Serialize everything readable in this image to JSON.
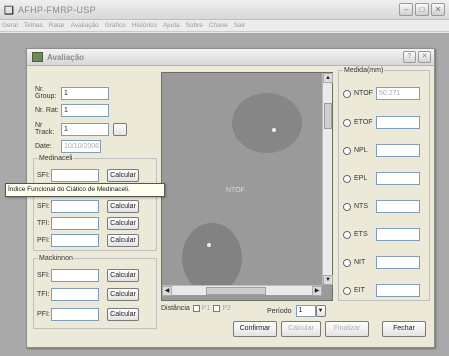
{
  "app": {
    "title": "AFHP-FMRP-USP",
    "menu": [
      "Geral",
      "Telhas",
      "Ratar",
      "Avaliação",
      "Gráfico",
      "Histórico",
      "Ajuda",
      "Sobre",
      "Chave",
      "Sair"
    ]
  },
  "dialog": {
    "title": "Avaliação",
    "fields": {
      "group_label": "Nr. Group:",
      "group_value": "1",
      "rat_label": "Nr. Rat:",
      "rat_value": "1",
      "track_label": "Nr Track:",
      "track_value": "1",
      "date_label": "Date:",
      "date_value": "10/10/2006"
    },
    "medinaceli": {
      "legend": "Medinaceli",
      "rows": [
        {
          "label": "SFI:",
          "button": "Calcular"
        },
        {
          "label": "SFI:",
          "button": "Calcular"
        },
        {
          "label": "TFI:",
          "button": "Calcular"
        },
        {
          "label": "PFI:",
          "button": "Calcular"
        }
      ]
    },
    "mackinnon": {
      "legend": "Mackinnon",
      "rows": [
        {
          "label": "SFI:",
          "button": "Calcular"
        },
        {
          "label": "TFI:",
          "button": "Calcular"
        },
        {
          "label": "PFI:",
          "button": "Calcular"
        }
      ]
    },
    "tooltip": "Índice Funcional do Ciático de Medinaceli.",
    "image_label": "NTOF",
    "medidas": {
      "legend": "Medida(mm)",
      "items": [
        {
          "label": "NTOF",
          "value": "50.271"
        },
        {
          "label": "ETOF",
          "value": ""
        },
        {
          "label": "NPL",
          "value": ""
        },
        {
          "label": "EPL",
          "value": ""
        },
        {
          "label": "NTS",
          "value": ""
        },
        {
          "label": "ETS",
          "value": ""
        },
        {
          "label": "NIT",
          "value": ""
        },
        {
          "label": "EIT",
          "value": ""
        }
      ]
    },
    "distancia": {
      "label": "Distância",
      "p1": "P1",
      "p2": "P2"
    },
    "periodo": {
      "label": "Período",
      "value": "1"
    },
    "buttons": {
      "confirmar": "Confirmar",
      "calcular": "Calcular",
      "finalizar": "Finalizar",
      "fechar": "Fechar"
    }
  }
}
